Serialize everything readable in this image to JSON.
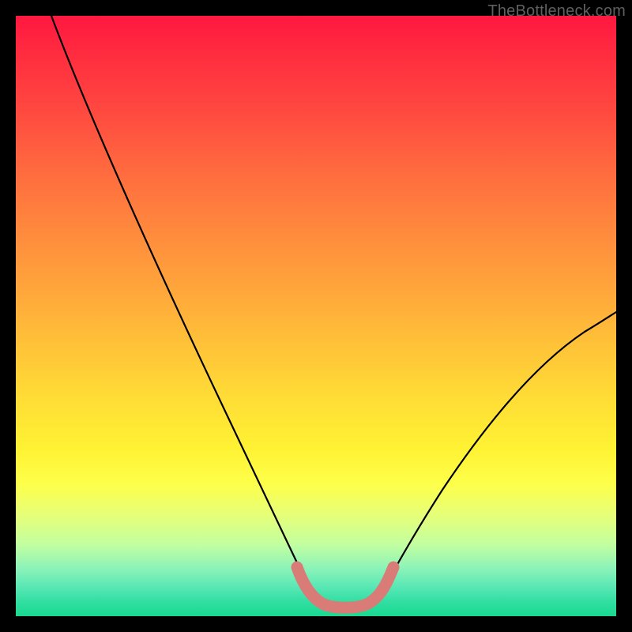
{
  "attribution": "TheBottleneck.com",
  "chart_data": {
    "type": "line",
    "title": "",
    "xlabel": "",
    "ylabel": "",
    "xlim": [
      0,
      100
    ],
    "ylim": [
      0,
      100
    ],
    "background": "rainbow-gradient-vertical",
    "series": [
      {
        "name": "bottleneck-curve-left",
        "kind": "thin-black",
        "points": [
          {
            "x": 6,
            "y": 100
          },
          {
            "x": 10,
            "y": 88
          },
          {
            "x": 16,
            "y": 74
          },
          {
            "x": 22,
            "y": 61
          },
          {
            "x": 28,
            "y": 48
          },
          {
            "x": 34,
            "y": 35
          },
          {
            "x": 40,
            "y": 22
          },
          {
            "x": 44,
            "y": 13
          },
          {
            "x": 47,
            "y": 7
          },
          {
            "x": 49,
            "y": 4
          }
        ]
      },
      {
        "name": "bottleneck-curve-right",
        "kind": "thin-black",
        "points": [
          {
            "x": 60,
            "y": 4
          },
          {
            "x": 63,
            "y": 8
          },
          {
            "x": 67,
            "y": 14
          },
          {
            "x": 72,
            "y": 22
          },
          {
            "x": 78,
            "y": 30
          },
          {
            "x": 84,
            "y": 37
          },
          {
            "x": 90,
            "y": 43
          },
          {
            "x": 96,
            "y": 48
          },
          {
            "x": 100,
            "y": 51
          }
        ]
      },
      {
        "name": "optimal-zone-marker",
        "kind": "thick-salmon",
        "points": [
          {
            "x": 46.5,
            "y": 8.5
          },
          {
            "x": 48,
            "y": 5
          },
          {
            "x": 50,
            "y": 2.5
          },
          {
            "x": 53,
            "y": 1.8
          },
          {
            "x": 56,
            "y": 1.8
          },
          {
            "x": 59,
            "y": 2.5
          },
          {
            "x": 61,
            "y": 5
          },
          {
            "x": 62.5,
            "y": 8.5
          }
        ]
      }
    ]
  }
}
